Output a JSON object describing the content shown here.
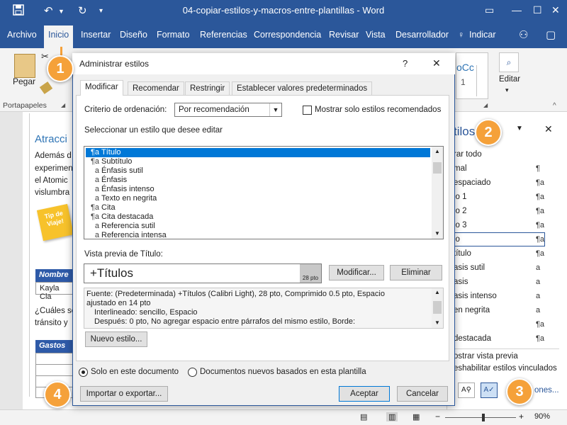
{
  "window": {
    "title": "04-copiar-estilos-y-macros-entre-plantillas - Word"
  },
  "menu": {
    "archivo": "Archivo",
    "inicio": "Inicio",
    "insertar": "Insertar",
    "diseno": "Diseño",
    "formato": "Formato",
    "referencias": "Referencias",
    "correspondencia": "Correspondencia",
    "revisar": "Revisar",
    "vista": "Vista",
    "desarrollador": "Desarrollador",
    "indicar": "Indicar"
  },
  "ribbon": {
    "pegar": "Pegar",
    "portapapeles": "Portapapeles",
    "editar": "Editar",
    "style_preview": "oCc",
    "style_preview2": "1"
  },
  "document": {
    "heading": "Atracci",
    "lines": [
      "Además d",
      "experimen",
      "el Atomic",
      "vislumbra"
    ],
    "sticker": "Tip de Viaje!",
    "table_header": "Nombre",
    "table_cell": "Kayla Cla",
    "question_lines": [
      "¿Cuáles so",
      "tránsito y"
    ],
    "gastos": "Gastos"
  },
  "sidepane": {
    "title": "tilos",
    "items": [
      {
        "label": "rar todo",
        "icon": ""
      },
      {
        "label": "mal",
        "icon": "¶"
      },
      {
        "label": "espaciado",
        "icon": "¶a"
      },
      {
        "label": "lo 1",
        "icon": "¶a"
      },
      {
        "label": "lo 2",
        "icon": "¶a"
      },
      {
        "label": "lo 3",
        "icon": "¶a"
      },
      {
        "label": "lo",
        "icon": "¶a"
      },
      {
        "label": "título",
        "icon": "¶a"
      },
      {
        "label": "asis sutil",
        "icon": "a"
      },
      {
        "label": "asis",
        "icon": "a"
      },
      {
        "label": "asis intenso",
        "icon": "a"
      },
      {
        "label": "en negrita",
        "icon": "a"
      },
      {
        "label": "",
        "icon": "¶a"
      },
      {
        "label": " destacada",
        "icon": "¶a"
      }
    ],
    "preview_check": "ostrar vista previa",
    "linked_check": "eshabilitar estilos vinculados",
    "options_link": "ones..."
  },
  "dialog": {
    "title": "Administrar estilos",
    "help": "?",
    "tabs": [
      "Modificar",
      "Recomendar",
      "Restringir",
      "Establecer valores predeterminados"
    ],
    "sort_label": "Criterio de ordenación:",
    "sort_value": "Por recomendación",
    "recommended_only": "Mostrar solo estilos recomendados",
    "select_label": "Seleccionar un estilo que desee editar",
    "styles": [
      {
        "glyph": "¶a",
        "name": "Título",
        "selected": true
      },
      {
        "glyph": "¶a",
        "name": "Subtítulo"
      },
      {
        "glyph": "a",
        "name": "Énfasis sutil"
      },
      {
        "glyph": "a",
        "name": "Énfasis"
      },
      {
        "glyph": "a",
        "name": "Énfasis intenso"
      },
      {
        "glyph": "a",
        "name": "Texto en negrita"
      },
      {
        "glyph": "¶a",
        "name": "Cita"
      },
      {
        "glyph": "¶a",
        "name": "Cita destacada"
      },
      {
        "glyph": "a",
        "name": "Referencia sutil"
      },
      {
        "glyph": "a",
        "name": "Referencia intensa"
      }
    ],
    "preview_label": "Vista previa de Título:",
    "preview_text": "+Títulos",
    "preview_size": "28 pto",
    "modify_button": "Modificar...",
    "delete_button": "Eliminar",
    "description": [
      "Fuente: (Predeterminada) +Títulos (Calibri Light), 28 pto, Comprimido  0.5 pto, Espacio",
      "ajustado en 14 pto",
      "Interlineado:  sencillo, Espacio",
      "Después:  0 pto, No agregar espacio entre párrafos del mismo estilo, Borde:"
    ],
    "new_style_button": "Nuevo estilo...",
    "radio_doc": "Solo en este documento",
    "radio_template": "Documentos nuevos basados en esta plantilla",
    "import_button": "Importar o exportar...",
    "ok_button": "Aceptar",
    "cancel_button": "Cancelar"
  },
  "callouts": [
    "1",
    "2",
    "3",
    "4"
  ],
  "status": {
    "zoom": "90%"
  }
}
